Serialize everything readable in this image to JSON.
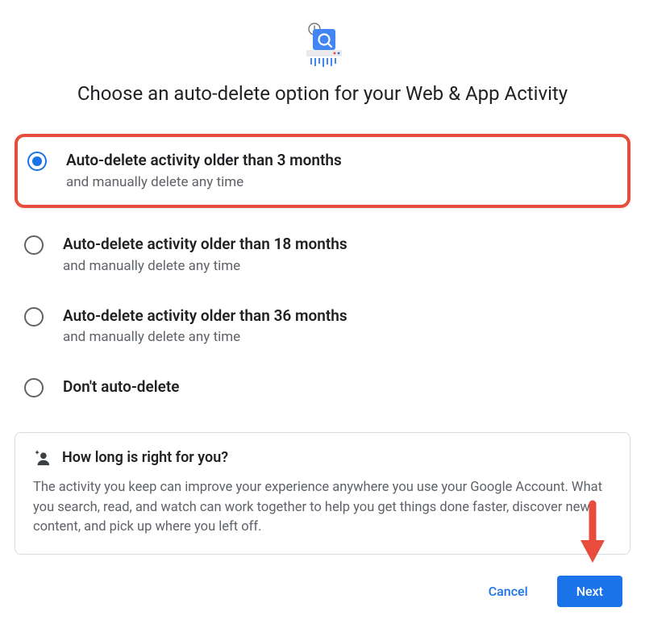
{
  "title": "Choose an auto-delete option for your Web & App Activity",
  "options": [
    {
      "title": "Auto-delete activity older than 3 months",
      "subtitle": "and manually delete any time",
      "selected": true,
      "highlighted": true
    },
    {
      "title": "Auto-delete activity older than 18 months",
      "subtitle": "and manually delete any time",
      "selected": false,
      "highlighted": false
    },
    {
      "title": "Auto-delete activity older than 36 months",
      "subtitle": "and manually delete any time",
      "selected": false,
      "highlighted": false
    },
    {
      "title": "Don't auto-delete",
      "subtitle": "",
      "selected": false,
      "highlighted": false
    }
  ],
  "info": {
    "title": "How long is right for you?",
    "body": "The activity you keep can improve your experience anywhere you use your Google Account. What you search, read, and watch can work together to help you get things done faster, discover new content, and pick up where you left off."
  },
  "actions": {
    "cancel": "Cancel",
    "next": "Next"
  }
}
